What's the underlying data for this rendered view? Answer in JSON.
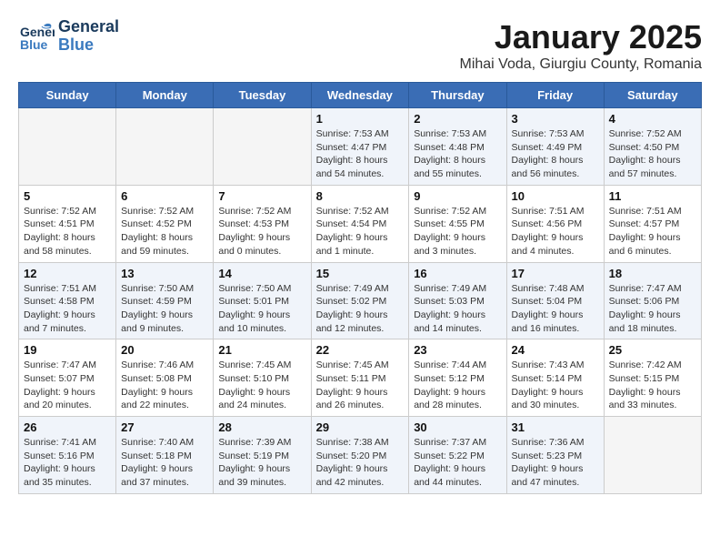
{
  "logo": {
    "line1": "General",
    "line2": "Blue"
  },
  "title": "January 2025",
  "subtitle": "Mihai Voda, Giurgiu County, Romania",
  "weekdays": [
    "Sunday",
    "Monday",
    "Tuesday",
    "Wednesday",
    "Thursday",
    "Friday",
    "Saturday"
  ],
  "weeks": [
    [
      {
        "day": "",
        "info": ""
      },
      {
        "day": "",
        "info": ""
      },
      {
        "day": "",
        "info": ""
      },
      {
        "day": "1",
        "info": "Sunrise: 7:53 AM\nSunset: 4:47 PM\nDaylight: 8 hours\nand 54 minutes."
      },
      {
        "day": "2",
        "info": "Sunrise: 7:53 AM\nSunset: 4:48 PM\nDaylight: 8 hours\nand 55 minutes."
      },
      {
        "day": "3",
        "info": "Sunrise: 7:53 AM\nSunset: 4:49 PM\nDaylight: 8 hours\nand 56 minutes."
      },
      {
        "day": "4",
        "info": "Sunrise: 7:52 AM\nSunset: 4:50 PM\nDaylight: 8 hours\nand 57 minutes."
      }
    ],
    [
      {
        "day": "5",
        "info": "Sunrise: 7:52 AM\nSunset: 4:51 PM\nDaylight: 8 hours\nand 58 minutes."
      },
      {
        "day": "6",
        "info": "Sunrise: 7:52 AM\nSunset: 4:52 PM\nDaylight: 8 hours\nand 59 minutes."
      },
      {
        "day": "7",
        "info": "Sunrise: 7:52 AM\nSunset: 4:53 PM\nDaylight: 9 hours\nand 0 minutes."
      },
      {
        "day": "8",
        "info": "Sunrise: 7:52 AM\nSunset: 4:54 PM\nDaylight: 9 hours\nand 1 minute."
      },
      {
        "day": "9",
        "info": "Sunrise: 7:52 AM\nSunset: 4:55 PM\nDaylight: 9 hours\nand 3 minutes."
      },
      {
        "day": "10",
        "info": "Sunrise: 7:51 AM\nSunset: 4:56 PM\nDaylight: 9 hours\nand 4 minutes."
      },
      {
        "day": "11",
        "info": "Sunrise: 7:51 AM\nSunset: 4:57 PM\nDaylight: 9 hours\nand 6 minutes."
      }
    ],
    [
      {
        "day": "12",
        "info": "Sunrise: 7:51 AM\nSunset: 4:58 PM\nDaylight: 9 hours\nand 7 minutes."
      },
      {
        "day": "13",
        "info": "Sunrise: 7:50 AM\nSunset: 4:59 PM\nDaylight: 9 hours\nand 9 minutes."
      },
      {
        "day": "14",
        "info": "Sunrise: 7:50 AM\nSunset: 5:01 PM\nDaylight: 9 hours\nand 10 minutes."
      },
      {
        "day": "15",
        "info": "Sunrise: 7:49 AM\nSunset: 5:02 PM\nDaylight: 9 hours\nand 12 minutes."
      },
      {
        "day": "16",
        "info": "Sunrise: 7:49 AM\nSunset: 5:03 PM\nDaylight: 9 hours\nand 14 minutes."
      },
      {
        "day": "17",
        "info": "Sunrise: 7:48 AM\nSunset: 5:04 PM\nDaylight: 9 hours\nand 16 minutes."
      },
      {
        "day": "18",
        "info": "Sunrise: 7:47 AM\nSunset: 5:06 PM\nDaylight: 9 hours\nand 18 minutes."
      }
    ],
    [
      {
        "day": "19",
        "info": "Sunrise: 7:47 AM\nSunset: 5:07 PM\nDaylight: 9 hours\nand 20 minutes."
      },
      {
        "day": "20",
        "info": "Sunrise: 7:46 AM\nSunset: 5:08 PM\nDaylight: 9 hours\nand 22 minutes."
      },
      {
        "day": "21",
        "info": "Sunrise: 7:45 AM\nSunset: 5:10 PM\nDaylight: 9 hours\nand 24 minutes."
      },
      {
        "day": "22",
        "info": "Sunrise: 7:45 AM\nSunset: 5:11 PM\nDaylight: 9 hours\nand 26 minutes."
      },
      {
        "day": "23",
        "info": "Sunrise: 7:44 AM\nSunset: 5:12 PM\nDaylight: 9 hours\nand 28 minutes."
      },
      {
        "day": "24",
        "info": "Sunrise: 7:43 AM\nSunset: 5:14 PM\nDaylight: 9 hours\nand 30 minutes."
      },
      {
        "day": "25",
        "info": "Sunrise: 7:42 AM\nSunset: 5:15 PM\nDaylight: 9 hours\nand 33 minutes."
      }
    ],
    [
      {
        "day": "26",
        "info": "Sunrise: 7:41 AM\nSunset: 5:16 PM\nDaylight: 9 hours\nand 35 minutes."
      },
      {
        "day": "27",
        "info": "Sunrise: 7:40 AM\nSunset: 5:18 PM\nDaylight: 9 hours\nand 37 minutes."
      },
      {
        "day": "28",
        "info": "Sunrise: 7:39 AM\nSunset: 5:19 PM\nDaylight: 9 hours\nand 39 minutes."
      },
      {
        "day": "29",
        "info": "Sunrise: 7:38 AM\nSunset: 5:20 PM\nDaylight: 9 hours\nand 42 minutes."
      },
      {
        "day": "30",
        "info": "Sunrise: 7:37 AM\nSunset: 5:22 PM\nDaylight: 9 hours\nand 44 minutes."
      },
      {
        "day": "31",
        "info": "Sunrise: 7:36 AM\nSunset: 5:23 PM\nDaylight: 9 hours\nand 47 minutes."
      },
      {
        "day": "",
        "info": ""
      }
    ]
  ]
}
